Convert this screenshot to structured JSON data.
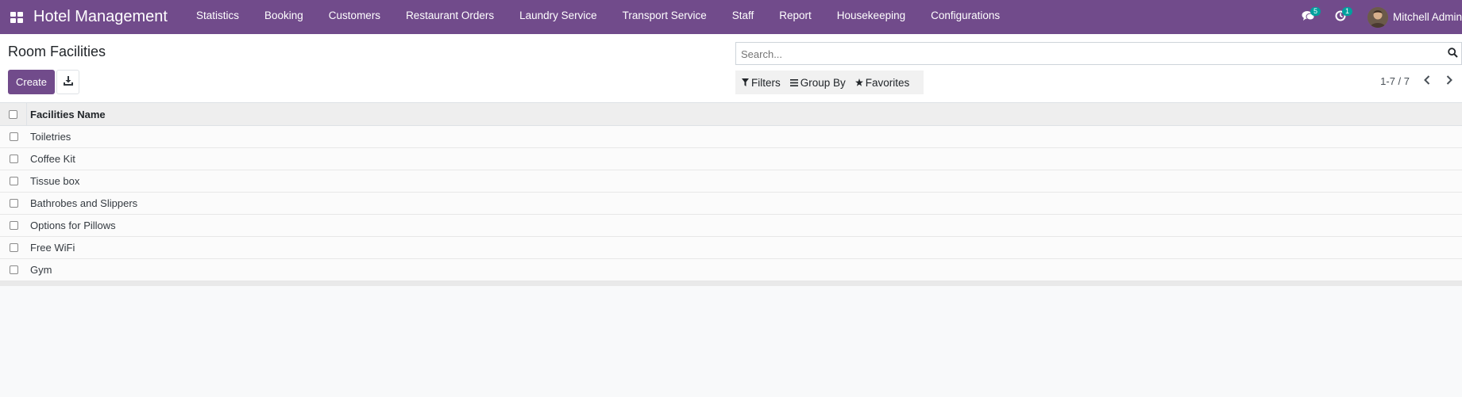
{
  "navbar": {
    "brand": "Hotel Management",
    "menu": [
      "Statistics",
      "Booking",
      "Customers",
      "Restaurant Orders",
      "Laundry Service",
      "Transport Service",
      "Staff",
      "Report",
      "Housekeeping",
      "Configurations"
    ],
    "messages_count": "5",
    "activities_count": "1",
    "user_name": "Mitchell Admin",
    "color": "#714b8b"
  },
  "control_panel": {
    "title": "Room Facilities",
    "create_label": "Create",
    "search_placeholder": "Search...",
    "filters_label": "Filters",
    "group_by_label": "Group By",
    "favorites_label": "Favorites",
    "pager_text": "1-7 / 7"
  },
  "list": {
    "column": "Facilities Name",
    "rows": [
      "Toiletries",
      "Coffee Kit",
      "Tissue box",
      "Bathrobes and Slippers",
      "Options for Pillows",
      "Free WiFi",
      "Gym"
    ]
  }
}
